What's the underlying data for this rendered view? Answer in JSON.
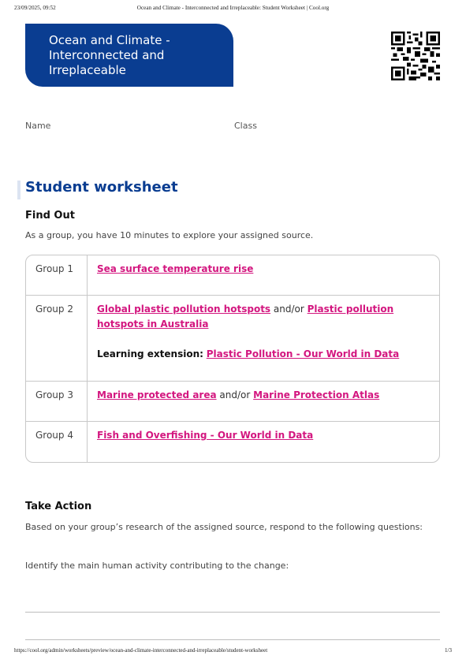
{
  "print_header": {
    "date": "23/09/2025, 09:52",
    "title": "Ocean and Climate - Interconnected and Irreplaceable: Student Worksheet | Cool.org"
  },
  "title_lines": [
    "Ocean and Climate -",
    "Interconnected and",
    "Irreplaceable"
  ],
  "form": {
    "name_label": "Name",
    "class_label": "Class"
  },
  "section_title": "Student worksheet",
  "find_out": {
    "heading": "Find Out",
    "instruction": "As a group, you have 10 minutes to explore your assigned source."
  },
  "groups": [
    {
      "label": "Group 1",
      "link1": "Sea surface temperature rise"
    },
    {
      "label": "Group 2",
      "link1": "Global plastic pollution hotspots",
      "connector": "and/or",
      "link2": "Plastic pollution hotspots in Australia",
      "extension_label": "Learning extension:",
      "extension_link": "Plastic Pollution - Our World in Data"
    },
    {
      "label": "Group 3",
      "link1": "Marine protected area",
      "connector": "and/or",
      "link2": "Marine Protection Atlas"
    },
    {
      "label": "Group 4",
      "link1": "Fish and Overfishing - Our World in Data"
    }
  ],
  "take_action": {
    "heading": "Take Action",
    "instruction": "Based on your group’s research of the assigned source, respond to the following questions:",
    "question1": "Identify the main human activity contributing to the change:"
  },
  "print_footer": {
    "url": "https://cool.org/admin/worksheets/preview/ocean-and-climate-interconnected-and-irreplaceable/student-worksheet",
    "page": "1/3"
  },
  "colors": {
    "brand_blue": "#0a3d91",
    "link_pink": "#d3167f"
  }
}
